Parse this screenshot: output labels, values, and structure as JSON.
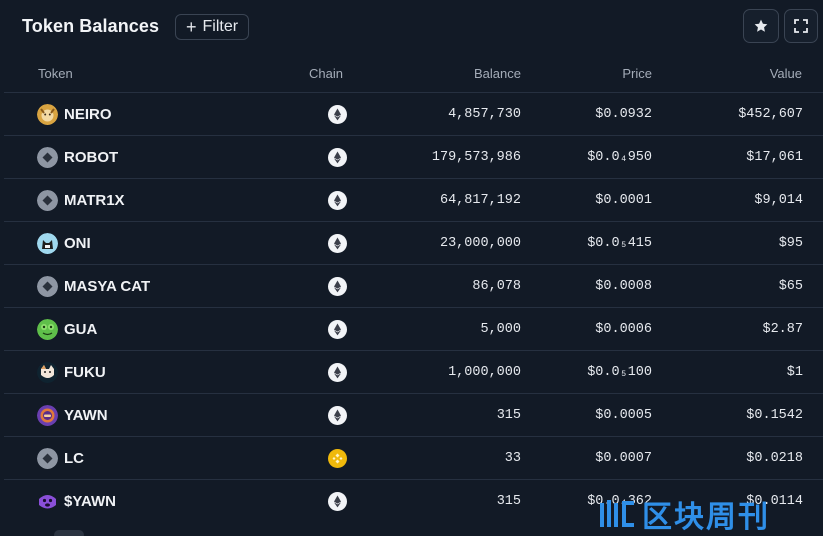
{
  "header": {
    "title": "Token Balances",
    "filter_label": "Filter"
  },
  "columns": {
    "token": "Token",
    "chain": "Chain",
    "balance": "Balance",
    "price": "Price",
    "value": "Value"
  },
  "rows": [
    {
      "name": "NEIRO",
      "icon": "neiro-dog-icon",
      "chain": "ethereum",
      "balance": "4,857,730",
      "price": "$0.0932",
      "value": "$452,607"
    },
    {
      "name": "ROBOT",
      "icon": "generic-token-icon",
      "chain": "ethereum",
      "balance": "179,573,986",
      "price": "$0.0₄950",
      "value": "$17,061"
    },
    {
      "name": "MATR1X",
      "icon": "generic-token-icon",
      "chain": "ethereum",
      "balance": "64,817,192",
      "price": "$0.0001",
      "value": "$9,014"
    },
    {
      "name": "ONI",
      "icon": "oni-cat-icon",
      "chain": "ethereum",
      "balance": "23,000,000",
      "price": "$0.0₅415",
      "value": "$95"
    },
    {
      "name": "MASYA CAT",
      "icon": "generic-token-icon",
      "chain": "ethereum",
      "balance": "86,078",
      "price": "$0.0008",
      "value": "$65"
    },
    {
      "name": "GUA",
      "icon": "gua-frog-icon",
      "chain": "ethereum",
      "balance": "5,000",
      "price": "$0.0006",
      "value": "$2.87"
    },
    {
      "name": "FUKU",
      "icon": "fuku-dog-icon",
      "chain": "ethereum",
      "balance": "1,000,000",
      "price": "$0.0₅100",
      "value": "$1"
    },
    {
      "name": "YAWN",
      "icon": "yawn-icon",
      "chain": "ethereum",
      "balance": "315",
      "price": "$0.0005",
      "value": "$0.1542"
    },
    {
      "name": "LC",
      "icon": "generic-token-icon",
      "chain": "bnb",
      "balance": "33",
      "price": "$0.0007",
      "value": "$0.0218"
    },
    {
      "name": "$YAWN",
      "icon": "yawn-purple-icon",
      "chain": "ethereum",
      "balance": "315",
      "price": "$0.0₄362",
      "value": "$0.0114"
    }
  ],
  "watermark": {
    "text": "区块周刊"
  },
  "colors": {
    "background": "#121a26",
    "row_border": "#263040",
    "eth_icon_bg": "#f2f4f7",
    "bnb_icon_bg": "#f0b90b",
    "generic_icon_bg": "#8e96a3",
    "watermark": "#2f8fe8"
  }
}
